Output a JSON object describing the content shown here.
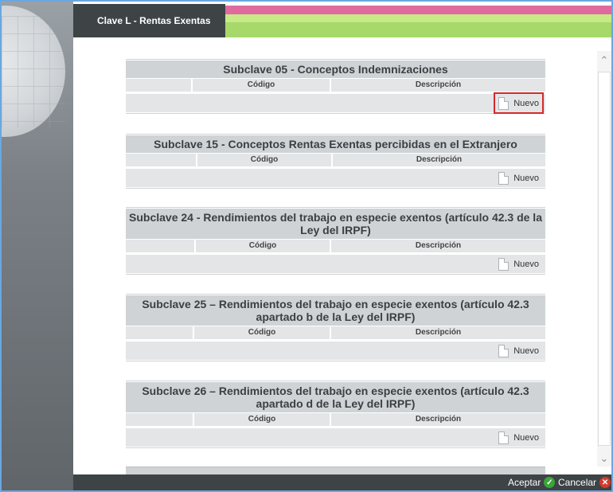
{
  "header": {
    "title": "Clave L - Rentas Exentas"
  },
  "sections": [
    {
      "title": "Subclave 05 - Conceptos Indemnizaciones",
      "col_code": "Código",
      "col_desc": "Descripción",
      "new_label": "Nuevo"
    },
    {
      "title": "Subclave 15 - Conceptos Rentas Exentas percibidas en el Extranjero",
      "col_code": "Código",
      "col_desc": "Descripción",
      "new_label": "Nuevo"
    },
    {
      "title": "Subclave 24 - Rendimientos del trabajo en especie exentos (artículo 42.3 de la Ley del IRPF)",
      "col_code": "Código",
      "col_desc": "Descripción",
      "new_label": "Nuevo"
    },
    {
      "title": "Subclave 25 – Rendimientos del trabajo en especie exentos (artículo 42.3 apartado b de la Ley del IRPF)",
      "col_code": "Código",
      "col_desc": "Descripción",
      "new_label": "Nuevo"
    },
    {
      "title": "Subclave 26 – Rendimientos del trabajo en especie exentos (artículo 42.3 apartado d de la Ley del IRPF)",
      "col_code": "Código",
      "col_desc": "Descripción",
      "new_label": "Nuevo"
    }
  ],
  "footer": {
    "accept_label": "Aceptar",
    "cancel_label": "Cancelar"
  },
  "icons": {
    "new": "document-icon",
    "accept": "check-circle-icon",
    "cancel": "close-circle-icon"
  },
  "colors": {
    "header_dark": "#3e4346",
    "stripe_pink": "#e06aa0",
    "stripe_green": "#a6d86a",
    "highlight": "#d42a2a"
  }
}
